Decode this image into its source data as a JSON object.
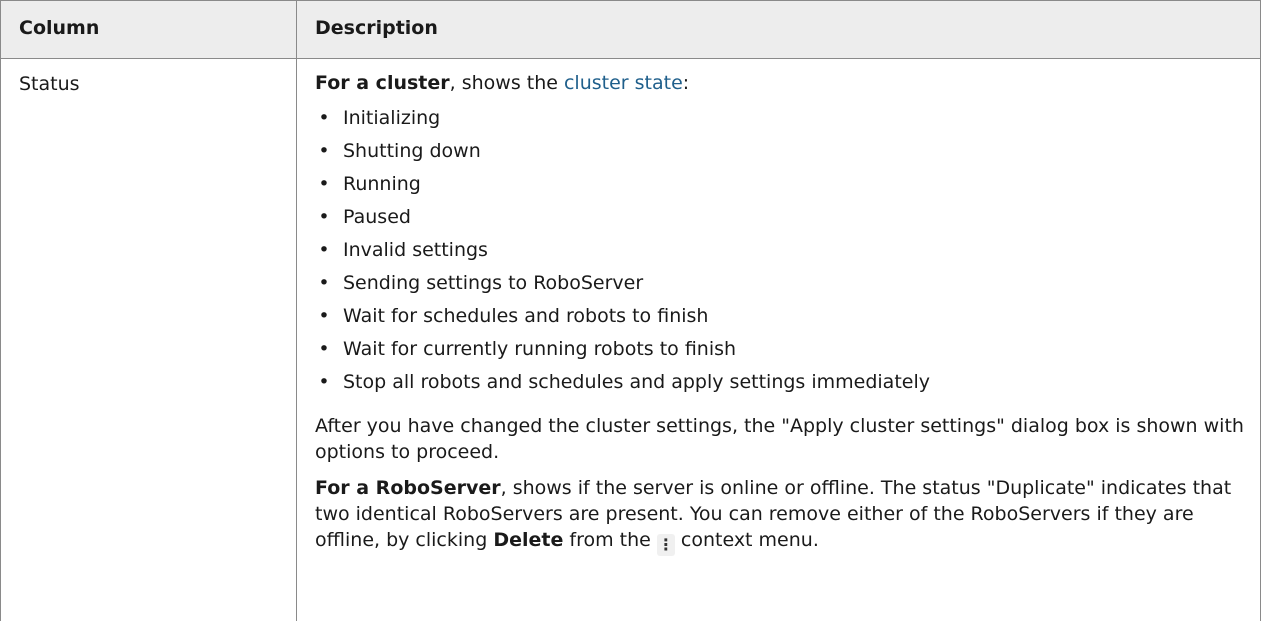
{
  "table": {
    "headers": [
      "Column",
      "Description"
    ],
    "row": {
      "column_name": "Status",
      "intro_bold": "For a cluster",
      "intro_mid": ", shows the ",
      "intro_link": "cluster state",
      "intro_end": ":",
      "states": [
        "Initializing",
        "Shutting down",
        "Running",
        "Paused",
        "Invalid settings",
        "Sending settings to RoboServer",
        "Wait for schedules and robots to finish",
        "Wait for currently running robots to finish",
        "Stop all robots and schedules and apply settings immediately"
      ],
      "para1": "After you have changed the cluster settings, the \"Apply cluster settings\" dialog box is shown with options to proceed.",
      "para2_bold": "For a RoboServer",
      "para2_text": ", shows if the server is online or offline. The status \"Duplicate\" indicates that two identical RoboServers are present. You can remove either of the RoboServers if they are offline, by clicking ",
      "para2_bold2": "Delete",
      "para2_mid": " from the ",
      "menu_glyph": "⋮",
      "para2_end": " context menu.",
      "bullet": "•"
    }
  },
  "colors": {
    "link": "#1f5f8b",
    "header_bg": "#ededed",
    "border": "#8a8a8a"
  },
  "icons": {
    "context_menu": "vertical-ellipsis-icon"
  }
}
